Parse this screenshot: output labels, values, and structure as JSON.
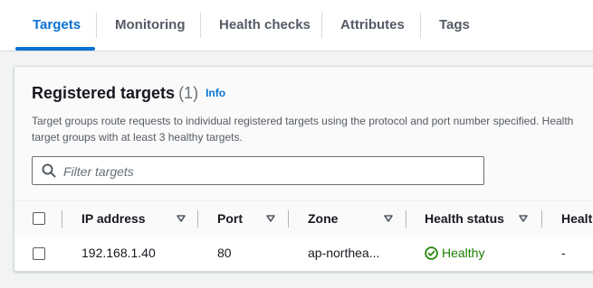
{
  "tabs": [
    {
      "label": "Targets",
      "active": true
    },
    {
      "label": "Monitoring",
      "active": false
    },
    {
      "label": "Health checks",
      "active": false
    },
    {
      "label": "Attributes",
      "active": false
    },
    {
      "label": "Tags",
      "active": false
    }
  ],
  "panel": {
    "title": "Registered targets",
    "count": "(1)",
    "info": "Info",
    "description_line1": "Target groups route requests to individual registered targets using the protocol and port number specified. Health",
    "description_line2": "target groups with at least 3 healthy targets."
  },
  "filter": {
    "placeholder": "Filter targets",
    "value": ""
  },
  "table": {
    "columns": [
      "IP address",
      "Port",
      "Zone",
      "Health status",
      "Healt"
    ],
    "rows": [
      {
        "ip": "192.168.1.40",
        "port": "80",
        "zone": "ap-northea...",
        "health_status": "Healthy",
        "health_details": "-"
      }
    ]
  },
  "colors": {
    "accent": "#0972d3",
    "healthy": "#1d8102",
    "text": "#16191f"
  },
  "icons": {
    "filter": "search-icon",
    "sort": "caret-down-icon",
    "healthy": "check-circle-icon"
  }
}
